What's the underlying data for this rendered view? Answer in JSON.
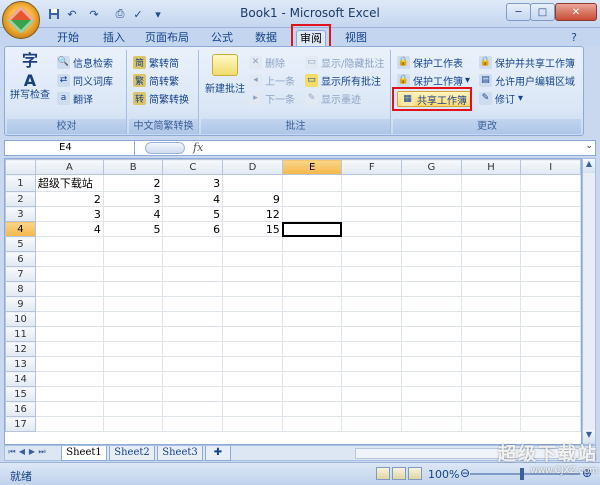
{
  "window": {
    "title": "Book1 - Microsoft Excel",
    "minimize": "─",
    "restore": "□",
    "close": "✕"
  },
  "quick_access": {
    "save_icon": "save-icon",
    "undo_glyph": "↶",
    "redo_glyph": "↷",
    "print_preview_glyph": "⎙",
    "customize_glyph": "▾"
  },
  "tabs": [
    "开始",
    "插入",
    "页面布局",
    "公式",
    "数据",
    "审阅",
    "视图"
  ],
  "active_tab": "审阅",
  "ribbon": {
    "proofing": {
      "label": "校对",
      "spell_check": "拼写检查",
      "research": "信息检索",
      "thesaurus": "同义词库",
      "translate": "翻译"
    },
    "chinese_convert": {
      "label": "中文简繁转换",
      "to_simplified": "繁转简",
      "to_traditional": "简转繁",
      "convert": "简繁转换"
    },
    "comments": {
      "label": "批注",
      "new_comment": "新建批注",
      "delete": "删除",
      "previous": "上一条",
      "next": "下一条",
      "show_hide": "显示/隐藏批注",
      "show_all": "显示所有批注",
      "show_ink": "显示墨迹"
    },
    "changes": {
      "label": "更改",
      "protect_sheet": "保护工作表",
      "protect_workbook": "保护工作簿",
      "share_workbook": "共享工作簿",
      "protect_share": "保护并共享工作簿",
      "allow_edit": "允许用户编辑区域",
      "track_changes": "修订"
    }
  },
  "formula_bar": {
    "name_box": "E4",
    "fx": "fx",
    "value": ""
  },
  "grid": {
    "columns": [
      "A",
      "B",
      "C",
      "D",
      "E",
      "F",
      "G",
      "H",
      "I"
    ],
    "active_column": "E",
    "active_row": "4",
    "rows": [
      {
        "n": "1",
        "cells": [
          "超级下载站",
          "2",
          "3",
          "",
          "",
          "",
          "",
          "",
          ""
        ]
      },
      {
        "n": "2",
        "cells": [
          "2",
          "3",
          "4",
          "9",
          "",
          "",
          "",
          "",
          ""
        ]
      },
      {
        "n": "3",
        "cells": [
          "3",
          "4",
          "5",
          "12",
          "",
          "",
          "",
          "",
          ""
        ]
      },
      {
        "n": "4",
        "cells": [
          "4",
          "5",
          "6",
          "15",
          "",
          "",
          "",
          "",
          ""
        ]
      },
      {
        "n": "5",
        "cells": [
          "",
          "",
          "",
          "",
          "",
          "",
          "",
          "",
          ""
        ]
      },
      {
        "n": "6",
        "cells": [
          "",
          "",
          "",
          "",
          "",
          "",
          "",
          "",
          ""
        ]
      },
      {
        "n": "7",
        "cells": [
          "",
          "",
          "",
          "",
          "",
          "",
          "",
          "",
          ""
        ]
      },
      {
        "n": "8",
        "cells": [
          "",
          "",
          "",
          "",
          "",
          "",
          "",
          "",
          ""
        ]
      },
      {
        "n": "9",
        "cells": [
          "",
          "",
          "",
          "",
          "",
          "",
          "",
          "",
          ""
        ]
      },
      {
        "n": "10",
        "cells": [
          "",
          "",
          "",
          "",
          "",
          "",
          "",
          "",
          ""
        ]
      },
      {
        "n": "11",
        "cells": [
          "",
          "",
          "",
          "",
          "",
          "",
          "",
          "",
          ""
        ]
      },
      {
        "n": "12",
        "cells": [
          "",
          "",
          "",
          "",
          "",
          "",
          "",
          "",
          ""
        ]
      },
      {
        "n": "13",
        "cells": [
          "",
          "",
          "",
          "",
          "",
          "",
          "",
          "",
          ""
        ]
      },
      {
        "n": "14",
        "cells": [
          "",
          "",
          "",
          "",
          "",
          "",
          "",
          "",
          ""
        ]
      },
      {
        "n": "15",
        "cells": [
          "",
          "",
          "",
          "",
          "",
          "",
          "",
          "",
          ""
        ]
      },
      {
        "n": "16",
        "cells": [
          "",
          "",
          "",
          "",
          "",
          "",
          "",
          "",
          ""
        ]
      },
      {
        "n": "17",
        "cells": [
          "",
          "",
          "",
          "",
          "",
          "",
          "",
          "",
          ""
        ]
      }
    ]
  },
  "sheets": [
    "Sheet1",
    "Sheet2",
    "Sheet3"
  ],
  "active_sheet": "Sheet1",
  "status": {
    "ready": "就绪",
    "zoom": "100%",
    "zoom_minus": "⊖",
    "zoom_plus": "⊕"
  },
  "watermark": {
    "big": "超级下载站",
    "url": "www.CJXZ.com"
  },
  "colors": {
    "highlight_red": "#e0121b",
    "active_header": "#f5b64a",
    "ribbon_blue": "#15428b"
  }
}
